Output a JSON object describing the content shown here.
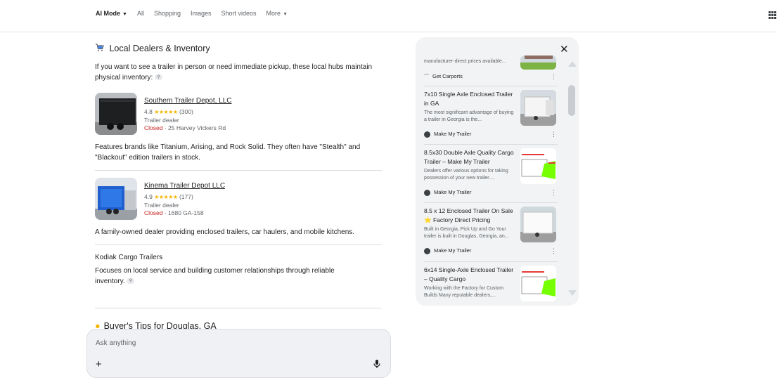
{
  "tabs": [
    "AI Mode",
    "All",
    "Shopping",
    "Images",
    "Short videos",
    "More"
  ],
  "section": {
    "icon": "cart-icon",
    "title": "Local Dealers & Inventory",
    "intro": "If you want to see a trailer in person or need immediate pickup, these local hubs maintain physical inventory:"
  },
  "dealers": [
    {
      "name": "Southern Trailer Depot, LLC",
      "rating": "4.8",
      "stars": "★★★★★",
      "reviews": "(300)",
      "type": "Trailer dealer",
      "status": "Closed",
      "address": "· 25 Harvey Vickers Rd",
      "note": "Features brands like Titanium, Arising, and Rock Solid. They often have \"Stealth\" and \"Blackout\" edition trailers in stock."
    },
    {
      "name": "Kinema Trailer Depot LLC",
      "rating": "4.9",
      "stars": "★★★★★",
      "reviews": "(177)",
      "type": "Trailer dealer",
      "status": "Closed",
      "address": "· 1680 GA-158",
      "note": "A family-owned dealer providing enclosed trailers, car haulers, and mobile kitchens."
    }
  ],
  "kodiak": {
    "title": "Kodiak Cargo Trailers",
    "text": "Focuses on local service and building customer relationships through reliable inventory."
  },
  "next_section": "Buyer's Tips for Douglas, GA",
  "ask": {
    "placeholder": "Ask anything",
    "plus": "+"
  },
  "panel": {
    "close": "✕",
    "cards": [
      {
        "title": "",
        "desc": "manufacturer-direct prices available...",
        "source": "Get Carports"
      },
      {
        "title": "7x10 Single Axle Enclosed Trailer in GA",
        "desc": "The most significant advantage of buying a trailer in Georgia is the...",
        "source": "Make My Trailer"
      },
      {
        "title": "8.5x30 Double Axle Quality Cargo Trailer – Make My Trailer",
        "desc": "Dealers offer various options for taking possession of your new trailer....",
        "source": "Make My Trailer"
      },
      {
        "title": "8.5 x 12 Enclosed Trailer On Sale ⭐ Factory Direct Pricing",
        "desc": "Built in Georgia, Pick Up and Go Your trailer is built in Douglas, Georgia, an...",
        "source": "Make My Trailer"
      },
      {
        "title": "6x14 Single-Axle Enclosed Trailer – Quality Cargo",
        "desc": "Working with the Factory for Custom Builds Many reputable dealers,...",
        "source": ""
      }
    ]
  }
}
